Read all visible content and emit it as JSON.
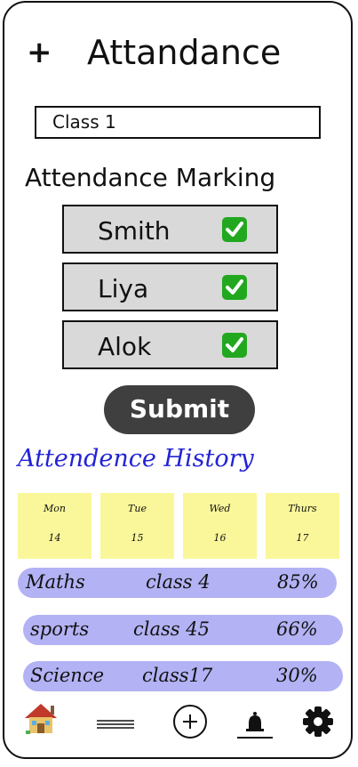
{
  "header": {
    "add_icon": "plus-icon",
    "title": "Attandance"
  },
  "class_select": {
    "value": "Class 1"
  },
  "marking": {
    "title": "Attendance Marking",
    "students": [
      {
        "name": "Smith",
        "present": true
      },
      {
        "name": "Liya",
        "present": true
      },
      {
        "name": "Alok",
        "present": true
      }
    ],
    "submit_label": "Submit"
  },
  "history": {
    "title": "Attendence History",
    "days": [
      {
        "name": "Mon",
        "date": "14"
      },
      {
        "name": "Tue",
        "date": "15"
      },
      {
        "name": "Wed",
        "date": "16"
      },
      {
        "name": "Thurs",
        "date": "17"
      }
    ],
    "rows": [
      {
        "subject": "Maths",
        "class": "class 4",
        "percent": "85%"
      },
      {
        "subject": "sports",
        "class": "class 45",
        "percent": "66%"
      },
      {
        "subject": "Science",
        "class": "class17",
        "percent": "30%"
      }
    ]
  },
  "bottom_nav": {
    "items": [
      "home-icon",
      "menu-icon",
      "add-circle-icon",
      "bell-icon",
      "gear-icon"
    ]
  },
  "colors": {
    "check": "#22a81f",
    "submit_bg": "#3f3f3f",
    "history_title": "#2323d6",
    "day_card": "#f9f79a",
    "history_row": "#b3b2f4",
    "student_card": "#d9d9d9"
  }
}
